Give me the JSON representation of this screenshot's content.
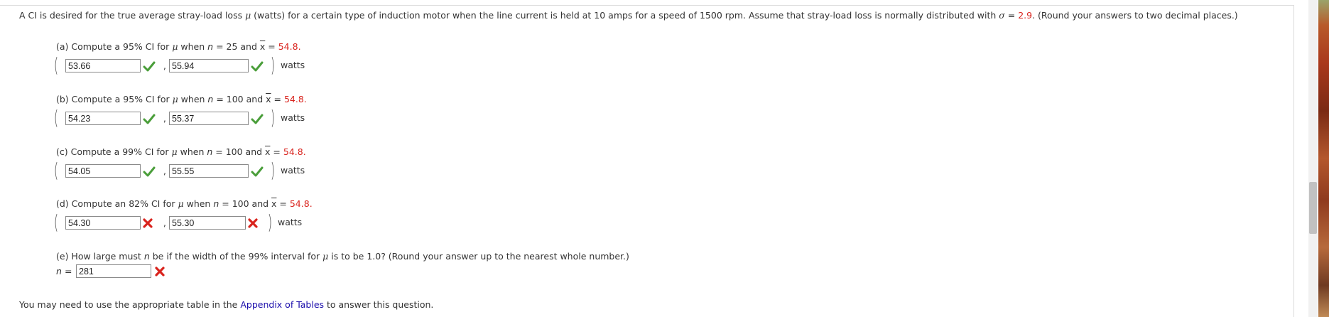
{
  "problem": {
    "intro_a": "A CI is desired for the true average stray-load loss ",
    "mu": "μ",
    "intro_b": " (watts) for a certain type of induction motor when the line current is held at 10 amps for a speed of 1500 rpm. Assume that stray-load loss is normally distributed with ",
    "sigma": "σ",
    "eq": " = ",
    "sigma_value": "2.9",
    "intro_c": ". (Round your answers to two decimal places.)"
  },
  "parts": [
    {
      "prefix": "(a) Compute a 95% CI for ",
      "mu": "μ",
      "when": " when ",
      "n_sym": "n",
      "n_eq": " = 25 and ",
      "xbar": "x",
      "xbar_eq": " = ",
      "xbar_value": "54.8",
      "end": ".",
      "lower": "53.66",
      "upper": "55.94",
      "lower_status": "correct",
      "upper_status": "correct",
      "unit": "watts"
    },
    {
      "prefix": "(b) Compute a 95% CI for ",
      "mu": "μ",
      "when": " when ",
      "n_sym": "n",
      "n_eq": " = 100 and ",
      "xbar": "x",
      "xbar_eq": " = ",
      "xbar_value": "54.8",
      "end": ".",
      "lower": "54.23",
      "upper": "55.37",
      "lower_status": "correct",
      "upper_status": "correct",
      "unit": "watts"
    },
    {
      "prefix": "(c) Compute a 99% CI for ",
      "mu": "μ",
      "when": " when ",
      "n_sym": "n",
      "n_eq": " = 100 and ",
      "xbar": "x",
      "xbar_eq": " = ",
      "xbar_value": "54.8",
      "end": ".",
      "lower": "54.05",
      "upper": "55.55",
      "lower_status": "correct",
      "upper_status": "correct",
      "unit": "watts"
    },
    {
      "prefix": "(d) Compute an 82% CI for ",
      "mu": "μ",
      "when": " when ",
      "n_sym": "n",
      "n_eq": " = 100 and ",
      "xbar": "x",
      "xbar_eq": " = ",
      "xbar_value": "54.8",
      "end": ".",
      "lower": "54.30",
      "upper": "55.30",
      "lower_status": "incorrect",
      "upper_status": "incorrect",
      "unit": "watts"
    }
  ],
  "part_e": {
    "prefix": "(e) How large must ",
    "n_sym": "n",
    "mid": " be if the width of the 99% interval for ",
    "mu": "μ",
    "suffix": " is to be 1.0? (Round your answer up to the nearest whole number.)",
    "label_n": "n",
    "label_eq": " = ",
    "value": "281",
    "status": "incorrect"
  },
  "footer": {
    "before": "You may need to use the appropriate table in the ",
    "link": "Appendix of Tables",
    "after": " to answer this question."
  },
  "separator": ",",
  "colors": {
    "correct": "#4a9e3a",
    "incorrect": "#d9231d",
    "given_value": "#d9231d",
    "link": "#1a0dab"
  },
  "icons": {
    "correct": "checkmark-icon",
    "incorrect": "x-mark-icon"
  }
}
